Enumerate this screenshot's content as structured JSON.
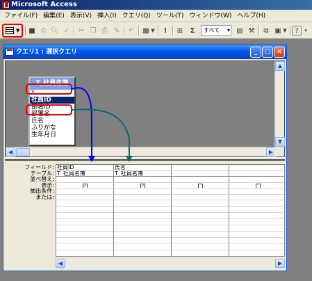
{
  "app": {
    "title": "Microsoft Access"
  },
  "menu": [
    "ファイル(F)",
    "編集(E)",
    "表示(V)",
    "挿入(I)",
    "クエリ(Q)",
    "ツール(T)",
    "ウィンドウ(W)",
    "ヘルプ(H)"
  ],
  "toolbar": {
    "query_type_value": "すべて",
    "icons": [
      "view",
      "save",
      "print",
      "print-preview",
      "spelling",
      "cut",
      "copy",
      "paste",
      "format-painter",
      "undo",
      "query-type",
      "run",
      "show-table",
      "totals",
      "top-values",
      "properties",
      "build",
      "database-window",
      "new-object",
      "help"
    ]
  },
  "query_window": {
    "title": "クエリ1 : 選択クエリ",
    "field_list": {
      "table_name": "T_社員名簿",
      "fields": [
        "*",
        "社員ID",
        "部署ID",
        "部署名",
        "氏名",
        "ふりがな",
        "生年月日"
      ]
    },
    "row_labels": [
      "フィールド:",
      "テーブル:",
      "並べ替え:",
      "表示:",
      "抽出条件:",
      "または:"
    ],
    "columns": [
      {
        "field": "社員ID",
        "table": "T_社員名簿",
        "show": true
      },
      {
        "field": "氏名",
        "table": "T_社員名簿",
        "show": true
      },
      {
        "field": "",
        "table": "",
        "show": false
      },
      {
        "field": "",
        "table": "",
        "show": false
      }
    ]
  },
  "colors": {
    "annotation_red": "#e00000",
    "arrow_blue": "#0000ff",
    "arrow_teal": "#006b6b",
    "highlight": "#0a246a"
  }
}
